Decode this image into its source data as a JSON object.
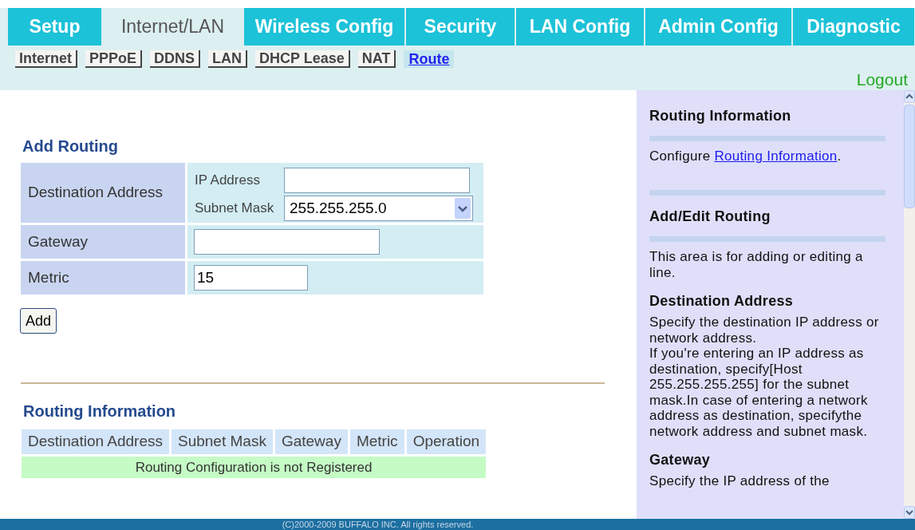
{
  "tabs": [
    {
      "label": "Setup",
      "selected": false
    },
    {
      "label": "Internet/LAN",
      "selected": true
    },
    {
      "label": "Wireless Config",
      "selected": false
    },
    {
      "label": "Security",
      "selected": false
    },
    {
      "label": "LAN Config",
      "selected": false
    },
    {
      "label": "Admin Config",
      "selected": false
    },
    {
      "label": "Diagnostic",
      "selected": false
    }
  ],
  "subtabs": [
    {
      "label": "Internet",
      "selected": false
    },
    {
      "label": "PPPoE",
      "selected": false
    },
    {
      "label": "DDNS",
      "selected": false
    },
    {
      "label": "LAN",
      "selected": false
    },
    {
      "label": "DHCP Lease",
      "selected": false
    },
    {
      "label": "NAT",
      "selected": false
    },
    {
      "label": "Route",
      "selected": true
    }
  ],
  "logout": "Logout",
  "add_routing": {
    "title": "Add Routing",
    "destination_label": "Destination Address",
    "ip_label": "IP Address",
    "mask_label": "Subnet Mask",
    "mask_value": "255.255.255.0",
    "gateway_label": "Gateway",
    "metric_label": "Metric",
    "metric_value": "15",
    "button": "Add"
  },
  "routing_information": {
    "title": "Routing Information",
    "columns": [
      "Destination Address",
      "Subnet Mask",
      "Gateway",
      "Metric",
      "Operation"
    ],
    "empty_message": "Routing Configuration is not Registered"
  },
  "help": {
    "sections": [
      {
        "title": "Routing Information",
        "rule": true,
        "text_before": "Configure ",
        "link": "Routing Information",
        "text_after": "."
      },
      {
        "title": "Add/Edit Routing",
        "rule": true,
        "paragraphs": [
          "This area is for adding or editing a line."
        ]
      },
      {
        "title": "Destination Address",
        "rule": false,
        "paragraphs": [
          "Specify the destination IP address or network address.",
          "If you're entering an IP address as destination, specify[Host 255.255.255.255] for the subnet mask.In case of entering a network address as destination, specifythe network address and subnet mask."
        ]
      },
      {
        "title": "Gateway",
        "rule": false,
        "paragraphs": [
          "Specify the IP address of the"
        ]
      }
    ]
  },
  "footer": "(C)2000-2009 BUFFALO INC. All rights reserved."
}
